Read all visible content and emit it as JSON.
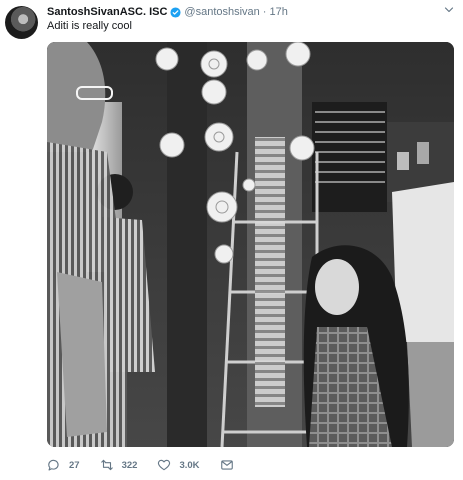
{
  "tweet": {
    "author_name": "SantoshSivanASC. ISC",
    "handle": "@santoshsivan",
    "separator": "·",
    "time": "17h",
    "text": "Aditi is really cool"
  },
  "actions": {
    "replies": "27",
    "retweets": "322",
    "likes": "3.0K"
  },
  "colors": {
    "verified": "#1da1f2",
    "secondary_text": "#657786"
  },
  "icons": [
    "verified-badge-icon",
    "chevron-down-icon",
    "reply-icon",
    "retweet-icon",
    "like-icon",
    "message-icon"
  ]
}
